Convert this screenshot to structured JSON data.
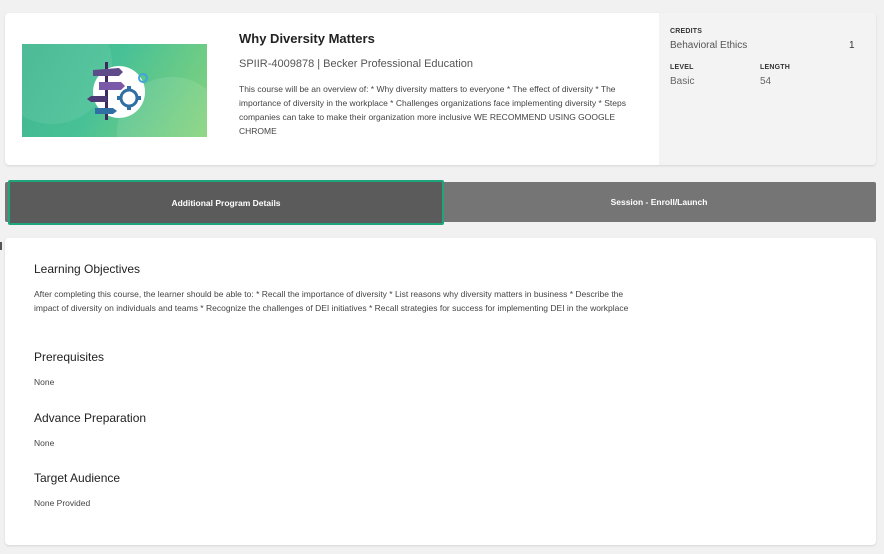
{
  "course": {
    "title": "Why Diversity Matters",
    "code_provider": "SPIIR-4009878 | Becker Professional Education",
    "description": "This course will be an overview of: * Why diversity matters to everyone * The effect of diversity * The importance of diversity in the workplace * Challenges organizations face implementing diversity * Steps companies can take to make their organization more inclusive WE RECOMMEND USING GOOGLE CHROME",
    "thumbnail_icon": "signpost-gears-icon"
  },
  "meta": {
    "credits_label": "CREDITS",
    "credits_category": "Behavioral Ethics",
    "credits_value": "1",
    "level_label": "LEVEL",
    "level_value": "Basic",
    "length_label": "LENGTH",
    "length_value": "54"
  },
  "tabs": [
    {
      "label": "Additional Program Details",
      "active": true
    },
    {
      "label": "Session - Enroll/Launch",
      "active": false
    }
  ],
  "sections": [
    {
      "heading": "Learning Objectives",
      "text": "After completing this course, the learner should be able to: * Recall the importance of diversity * List reasons why diversity matters in business * Describe the impact of diversity on individuals and teams * Recognize the challenges of DEI initiatives * Recall strategies for success for implementing DEI in the workplace"
    },
    {
      "heading": "Prerequisites",
      "text": "None"
    },
    {
      "heading": "Advance Preparation",
      "text": "None"
    },
    {
      "heading": "Target Audience",
      "text": "None Provided"
    }
  ],
  "colors": {
    "accent": "#1ea57b",
    "tab_bar": "#757575",
    "tab_active": "#5b5b5b"
  }
}
